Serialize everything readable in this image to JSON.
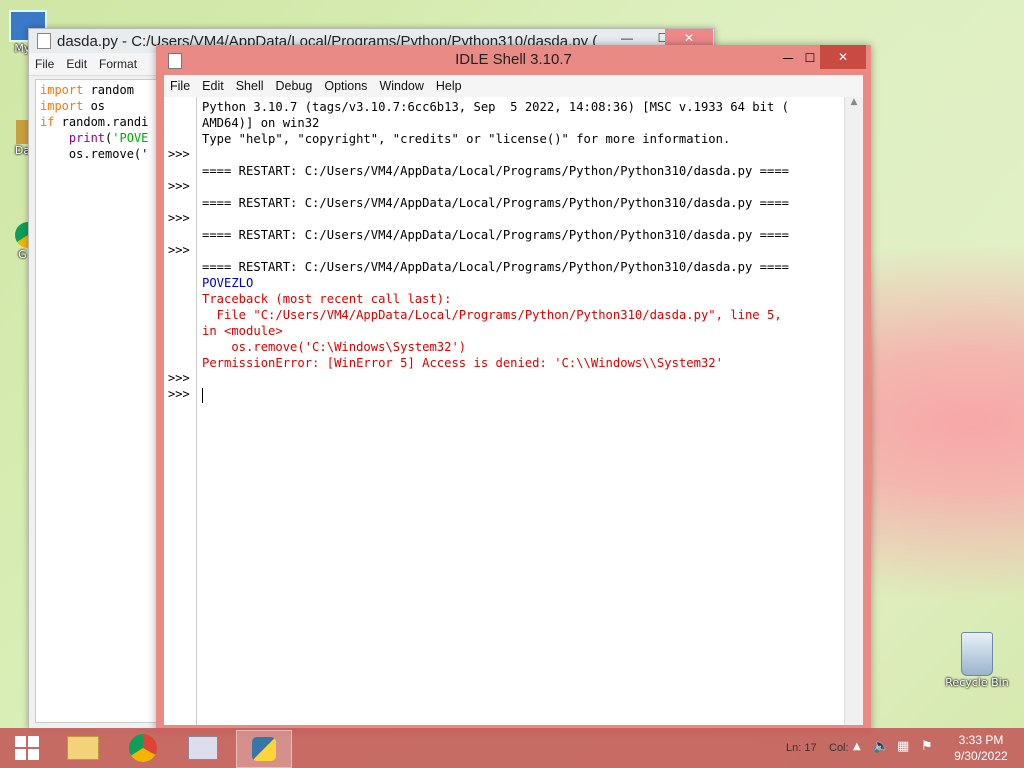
{
  "desktop": {
    "icons": [
      {
        "label": "My C"
      },
      {
        "label": "Data"
      },
      {
        "label": "G C"
      },
      {
        "label": "Recycle Bin"
      }
    ]
  },
  "editor": {
    "title": "dasda.py - C:/Users/VM4/AppData/Local/Programs/Python/Python310/dasda.py (",
    "menu": [
      "File",
      "Edit",
      "Format"
    ],
    "code": {
      "line1_kw": "import",
      "line1_rest": " random",
      "line2_kw": "import",
      "line2_rest": " os",
      "line3_kw": "if",
      "line3_rest": " random.randi",
      "line4_indent": "    ",
      "line4_bi": "print",
      "line4_rest": "(",
      "line4_str": "'POVE",
      "line5": "    os.remove('"
    }
  },
  "shell": {
    "title": "IDLE Shell 3.10.7",
    "menu": [
      "File",
      "Edit",
      "Shell",
      "Debug",
      "Options",
      "Window",
      "Help"
    ],
    "lines": {
      "l1": "Python 3.10.7 (tags/v3.10.7:6cc6b13, Sep  5 2022, 14:08:36) [MSC v.1933 64 bit (",
      "l2": "AMD64)] on win32",
      "l3": "Type \"help\", \"copyright\", \"credits\" or \"license()\" for more information.",
      "restart": "==== RESTART: C:/Users/VM4/AppData/Local/Programs/Python/Python310/dasda.py ====",
      "out": "POVEZLO",
      "tb1": "Traceback (most recent call last):",
      "tb2": "  File \"C:/Users/VM4/AppData/Local/Programs/Python/Python310/dasda.py\", line 5,",
      "tb3": "in <module>",
      "tb4": "    os.remove('C:\\Windows\\System32')",
      "tb5": "PermissionError: [WinError 5] Access is denied: 'C:\\\\Windows\\\\System32'"
    },
    "prompt": ">>>",
    "status": {
      "ln": "Ln: 17",
      "col": "Col:"
    }
  },
  "taskbar": {
    "time": "3:33 PM",
    "date": "9/30/2022"
  },
  "colors": {
    "accent": "#e98a85",
    "error": "#dd0000",
    "output": "#0000cc"
  }
}
